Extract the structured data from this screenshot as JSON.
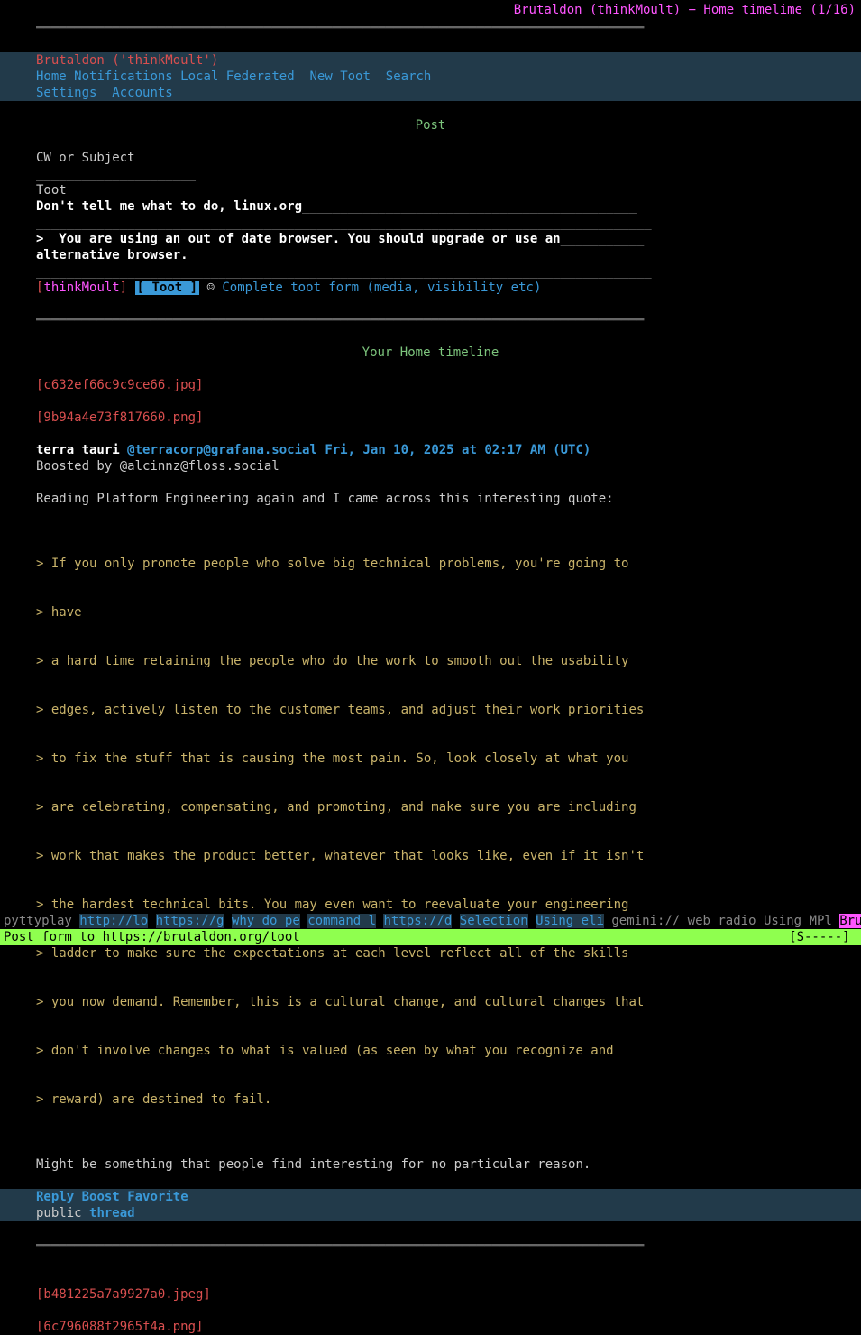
{
  "title": "Brutaldon (thinkMoult) − Home timelime (1/16)",
  "brand": "Brutaldon ('thinkMoult')",
  "nav": {
    "home": "Home",
    "notifications": "Notifications",
    "local": "Local",
    "federated": "Federated",
    "new_toot": "New Toot",
    "search": "Search",
    "settings": "Settings",
    "accounts": "Accounts"
  },
  "post": {
    "heading": "Post",
    "cw_label": "CW or Subject",
    "toot_label": "Toot",
    "body_l1": "Don't tell me what to do, linux.org",
    "body_l2": ">  You are using an out of date browser. You should upgrade or use an",
    "body_l3": "alternative browser.",
    "user": "thinkMoult",
    "button": " Toot ",
    "aux": "Complete toot form (media, visibility etc)"
  },
  "timeline_heading": "Your Home timeline",
  "entry": {
    "img1": "[c632ef66c9c9ce66.jpg]",
    "img2": "[9b94a4e73f817660.png]",
    "author": "terra tauri",
    "handle": "@terracorp@grafana.social",
    "timestamp": "Fri, Jan 10, 2025 at 02:17 AM (UTC)",
    "boosted": "Boosted by @alcinnz@floss.social",
    "intro": "Reading Platform Engineering again and I came across this interesting quote:",
    "quote": [
      "> If you only promote people who solve big technical problems, you're going to",
      "> have",
      "> a hard time retaining the people who do the work to smooth out the usability",
      "> edges, actively listen to the customer teams, and adjust their work priorities",
      "> to fix the stuff that is causing the most pain. So, look closely at what you",
      "> are celebrating, compensating, and promoting, and make sure you are including",
      "> work that makes the product better, whatever that looks like, even if it isn't",
      "> the hardest technical bits. You may even want to reevaluate your engineering",
      "> ladder to make sure the expectations at each level reflect all of the skills",
      "> you now demand. Remember, this is a cultural change, and cultural changes that",
      "> don't involve changes to what is valued (as seen by what you recognize and",
      "> reward) are destined to fail."
    ],
    "outro": "Might be something that people find interesting for no particular reason.",
    "reply": "Reply",
    "boost": "Boost",
    "favorite": "Favorite",
    "visibility": "public",
    "thread": "thread"
  },
  "entry2": {
    "img1": "[b481225a7a9927a0.jpeg]",
    "img2": "[6c796088f2965f4a.png]"
  },
  "tabs": {
    "t0": "pyttyplay",
    "t1": "http://lo",
    "t2": "https://g",
    "t3": "why do pe",
    "t4": "command l",
    "t5": "https://d",
    "t6": "Selection",
    "t7": "Using eli",
    "t8": "gemini:// web radio Using MPl",
    "t9": "Brutaldo"
  },
  "status": {
    "left": "Post form to https://brutaldon.org/toot",
    "right": "[S-----] "
  }
}
